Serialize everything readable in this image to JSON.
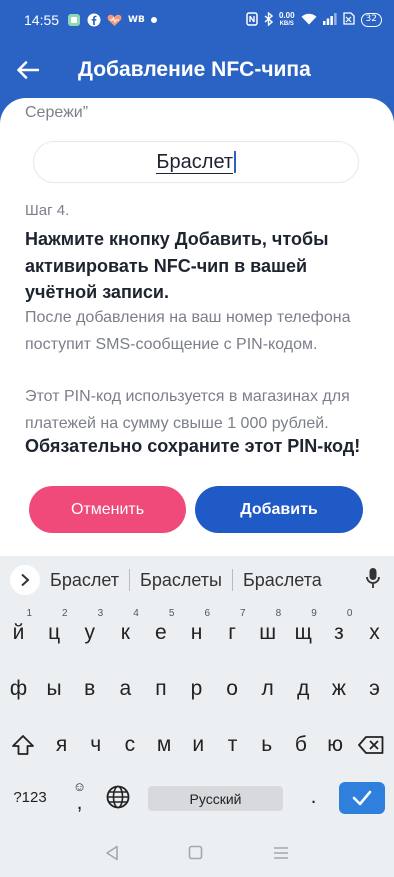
{
  "status": {
    "time": "14:55",
    "network_speed_value": "0.00",
    "network_speed_unit": "KB/S",
    "battery": "32",
    "wb_label": "WB"
  },
  "header": {
    "title": "Добавление NFC-чипа"
  },
  "form": {
    "prev_text": "Сережи”",
    "name_value": "Браслет",
    "step": "Шаг 4.",
    "instruction": "Нажмите кнопку Добавить, чтобы активировать NFC-чип в вашей учётной записи.",
    "note_sms": "После добавления на ваш номер телефона поступит SMS-сообщение с PIN-кодом.",
    "note_pin": "Этот PIN-код используется в магазинах для платежей на сумму свыше 1 000 рублей.",
    "warning": "Обязательно сохраните этот PIN-код!",
    "cancel_label": "Отменить",
    "add_label": "Добавить"
  },
  "keyboard": {
    "suggestions": [
      "Браслет",
      "Браслеты",
      "Браслета"
    ],
    "row1": [
      "й",
      "ц",
      "у",
      "к",
      "е",
      "н",
      "г",
      "ш",
      "щ",
      "з",
      "х"
    ],
    "row1_hints": [
      "1",
      "2",
      "3",
      "4",
      "5",
      "6",
      "7",
      "8",
      "9",
      "0",
      ""
    ],
    "row2": [
      "ф",
      "ы",
      "в",
      "а",
      "п",
      "р",
      "о",
      "л",
      "д",
      "ж",
      "э"
    ],
    "row3": [
      "я",
      "ч",
      "с",
      "м",
      "и",
      "т",
      "ь",
      "б",
      "ю"
    ],
    "symbols_label": "?123",
    "comma_label": ",",
    "space_label": "Русский",
    "period_label": "."
  },
  "colors": {
    "primary": "#2a63c4",
    "cancel": "#ef4a7a",
    "add": "#1f5ac7"
  }
}
